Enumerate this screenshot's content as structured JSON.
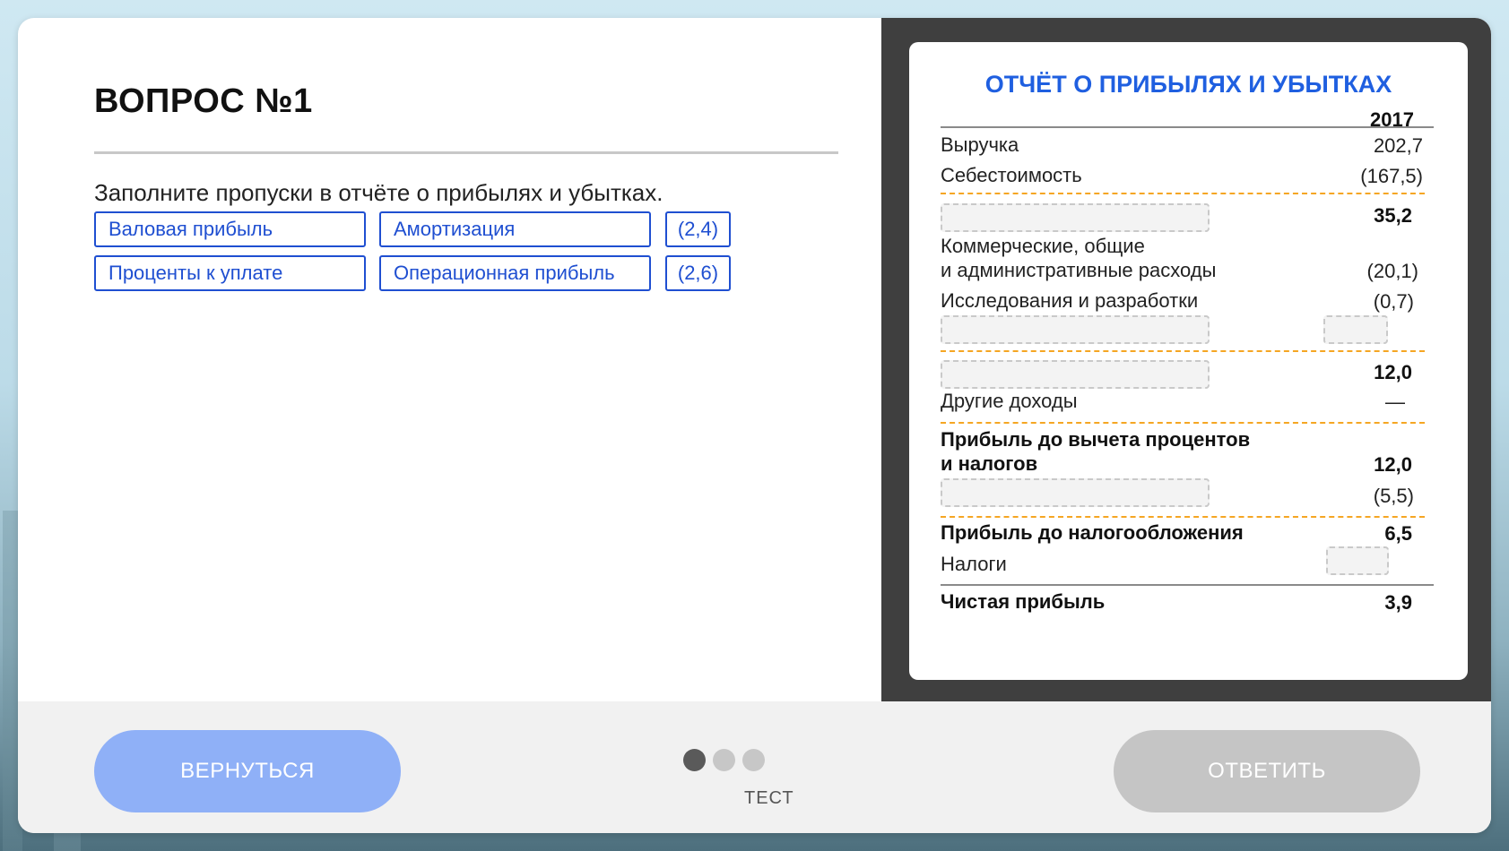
{
  "question": {
    "title": "ВОПРОС №1",
    "prompt": "Заполните пропуски в отчёте о прибылях и убытках.",
    "options": [
      "Валовая прибыль",
      "Амортизация",
      "(2,4)",
      "Проценты к уплате",
      "Операционная прибыль",
      "(2,6)"
    ]
  },
  "report": {
    "title": "ОТЧЁТ О ПРИБЫЛЯХ И УБЫТКАХ",
    "year": "2017",
    "rows": {
      "revenue": {
        "label": "Выручка",
        "value": "202,7"
      },
      "cogs": {
        "label": "Себестоимость",
        "value": "(167,5)"
      },
      "gross": {
        "label": "",
        "value": "35,2"
      },
      "sga_line1": "Коммерческие, общие",
      "sga_line2": "и административные расходы",
      "sga_value": "(20,1)",
      "rnd": {
        "label": "Исследования и разработки",
        "value": "(0,7)"
      },
      "operating": {
        "label": "",
        "value": "12,0"
      },
      "other": {
        "label": "Другие доходы",
        "value": "—"
      },
      "ebit_line1": "Прибыль до вычета процентов",
      "ebit_line2": "и налогов",
      "ebit_value": "12,0",
      "interest_value": "(5,5)",
      "ebt": {
        "label": "Прибыль до налогообложения",
        "value": "6,5"
      },
      "taxes": {
        "label": "Налоги",
        "value": ""
      },
      "net": {
        "label": "Чистая прибыль",
        "value": "3,9"
      }
    }
  },
  "footer": {
    "back_label": "ВЕРНУТЬСЯ",
    "answer_label": "ОТВЕТИТЬ",
    "progress_label": "ТЕСТ",
    "steps_total": 3,
    "step_current": 1
  },
  "colors": {
    "accent": "#1f4fd1",
    "title_blue": "#1f5fe0",
    "dash_orange": "#f5a623",
    "back_button": "#8fb0f7",
    "answer_button": "#c5c5c5"
  }
}
